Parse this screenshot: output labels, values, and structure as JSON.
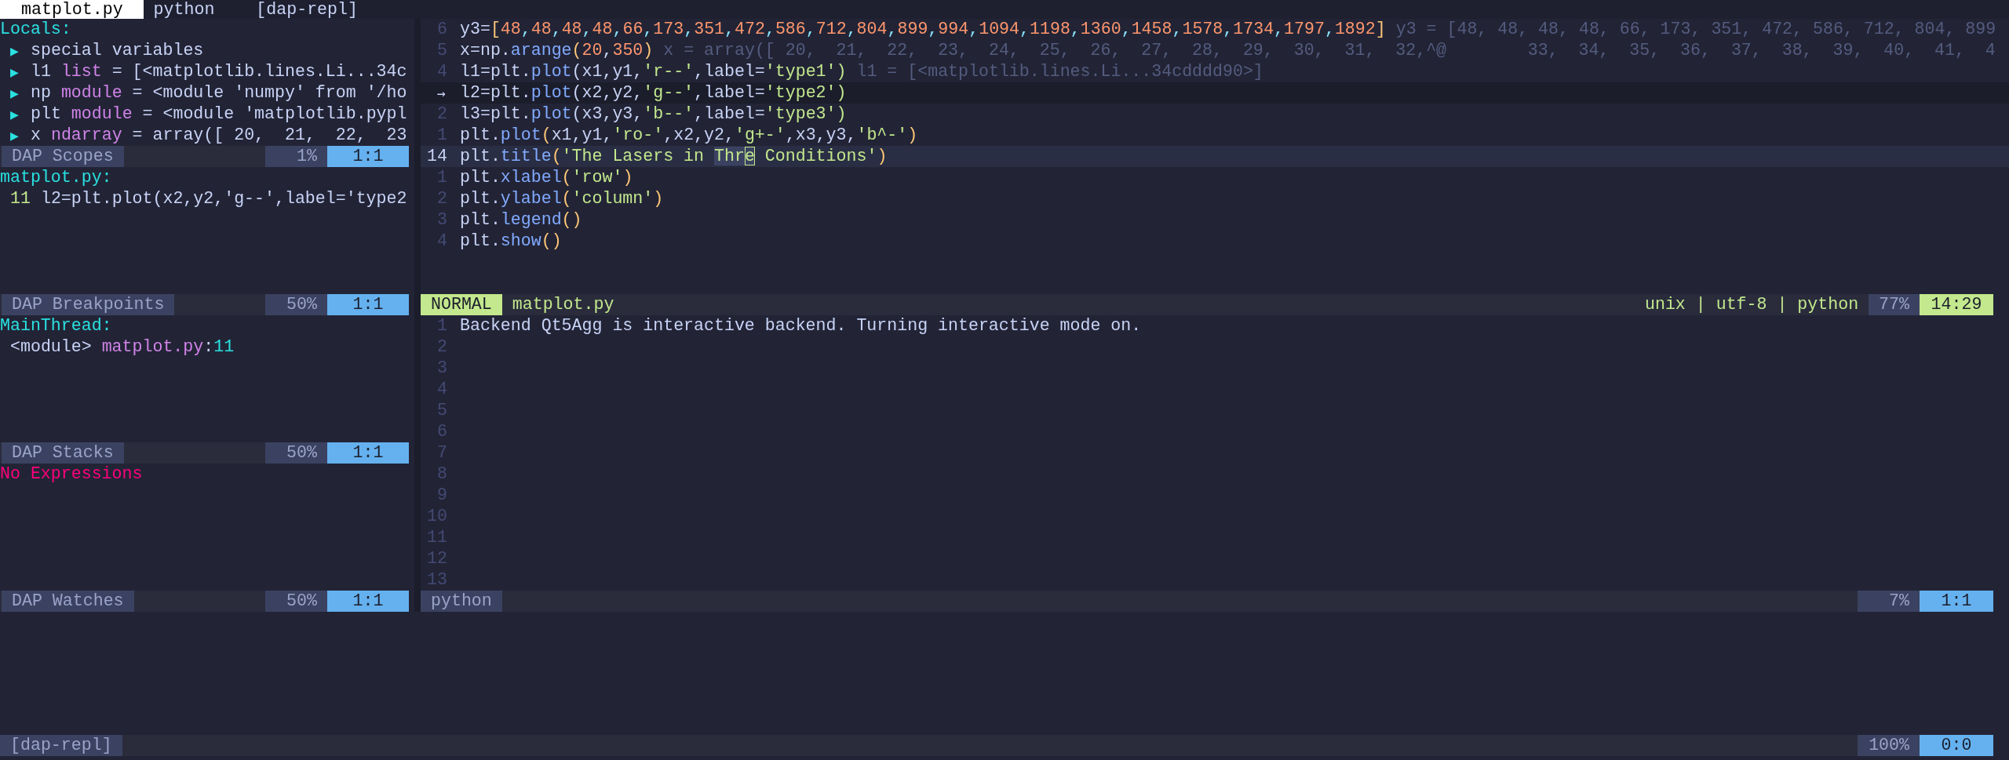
{
  "tabs": [
    {
      "label": "matplot.py",
      "selected": true
    },
    {
      "label": "python",
      "selected": false
    },
    {
      "label": "[dap-repl]",
      "selected": false
    }
  ],
  "scopes": {
    "header": "Locals:",
    "items": [
      {
        "marker": "▶",
        "kind": "group",
        "label": "special variables"
      },
      {
        "marker": "▶",
        "kind": "var",
        "name": "l1",
        "type": "list",
        "value": "= [<matplotlib.lines.Li...34c"
      },
      {
        "marker": "▶",
        "kind": "var",
        "name": "np",
        "type": "module",
        "value": "= <module 'numpy' from '/ho"
      },
      {
        "marker": "▶",
        "kind": "var",
        "name": "plt",
        "type": "module",
        "value": "= <module 'matplotlib.pypl"
      },
      {
        "marker": "▶",
        "kind": "var",
        "name": "x",
        "type": "ndarray",
        "value": "= array([ 20,  21,  22,  23"
      }
    ],
    "status": {
      "label": "DAP Scopes",
      "percent": "1%",
      "position": "1:1"
    }
  },
  "breakpoints": {
    "file": "matplot.py:",
    "lines": [
      {
        "number": "11",
        "code": "l2=plt.plot(x2,y2,'g--',label='type2"
      }
    ],
    "status": {
      "label": "DAP Breakpoints",
      "percent": "50%",
      "position": "1:1"
    }
  },
  "stacks": {
    "thread": "MainThread:",
    "frames": [
      {
        "name": "<module>",
        "file": "matplot.py",
        "separator": ":",
        "line": "11"
      }
    ],
    "status": {
      "label": "DAP Stacks",
      "percent": "50%",
      "position": "1:1"
    }
  },
  "watches": {
    "message": "No Expressions",
    "status": {
      "label": "DAP Watches",
      "percent": "50%",
      "position": "1:1"
    }
  },
  "editor": {
    "lines": [
      {
        "number": "6",
        "stopped": false,
        "cursor": false,
        "tokens": [
          {
            "kind": "plain",
            "text": "y3="
          },
          {
            "kind": "paren",
            "text": "["
          },
          {
            "kind": "array",
            "text": "48,48,48,48,66,173,351,472,586,712,804,899,994,1094,1198,1360,1458,1578,1734,1797,1892"
          },
          {
            "kind": "paren",
            "text": "]"
          }
        ],
        "virtual": "y3 = [48, 48, 48, 48, 66, 173, 351, 472, 586, 712, 804, 899"
      },
      {
        "number": "5",
        "stopped": false,
        "cursor": false,
        "tokens": [
          {
            "kind": "plain",
            "text": "x=np."
          },
          {
            "kind": "func",
            "text": "arange"
          },
          {
            "kind": "paren",
            "text": "("
          },
          {
            "kind": "number",
            "text": "20"
          },
          {
            "kind": "plain",
            "text": ","
          },
          {
            "kind": "number",
            "text": "350"
          },
          {
            "kind": "paren",
            "text": ")"
          }
        ],
        "virtual": "x = array([ 20,  21,  22,  23,  24,  25,  26,  27,  28,  29,  30,  31,  32,^@        33,  34,  35,  36,  37,  38,  39,  40,  41,  4"
      },
      {
        "number": "4",
        "stopped": false,
        "cursor": false,
        "tokens": [
          {
            "kind": "plain",
            "text": "l1=plt."
          },
          {
            "kind": "func",
            "text": "plot"
          },
          {
            "kind": "plain",
            "text": "(x1,y1,"
          },
          {
            "kind": "string",
            "text": "'r--'"
          },
          {
            "kind": "plain",
            "text": ",label="
          },
          {
            "kind": "string",
            "text": "'type1')"
          }
        ],
        "virtual": "l1 = [<matplotlib.lines.Li...34cdddd90>]"
      },
      {
        "number": "→",
        "stopped": true,
        "cursor": false,
        "tokens": [
          {
            "kind": "plain",
            "text": "l2=plt."
          },
          {
            "kind": "func",
            "text": "plot"
          },
          {
            "kind": "plain",
            "text": "(x2,y2,"
          },
          {
            "kind": "string",
            "text": "'g--'"
          },
          {
            "kind": "plain",
            "text": ",label="
          },
          {
            "kind": "string",
            "text": "'type2')"
          }
        ]
      },
      {
        "number": "2",
        "stopped": false,
        "cursor": false,
        "tokens": [
          {
            "kind": "plain",
            "text": "l3=plt."
          },
          {
            "kind": "func",
            "text": "plot"
          },
          {
            "kind": "plain",
            "text": "(x3,y3,"
          },
          {
            "kind": "string",
            "text": "'b--'"
          },
          {
            "kind": "plain",
            "text": ",label="
          },
          {
            "kind": "string",
            "text": "'type3')"
          }
        ]
      },
      {
        "number": "1",
        "stopped": false,
        "cursor": false,
        "tokens": [
          {
            "kind": "plain",
            "text": "plt."
          },
          {
            "kind": "func",
            "text": "plot"
          },
          {
            "kind": "paren",
            "text": "("
          },
          {
            "kind": "plain",
            "text": "x1,y1,"
          },
          {
            "kind": "string",
            "text": "'ro-'"
          },
          {
            "kind": "plain",
            "text": ",x2,y2,"
          },
          {
            "kind": "string",
            "text": "'g+-'"
          },
          {
            "kind": "plain",
            "text": ",x3,y3,"
          },
          {
            "kind": "string",
            "text": "'b^-'"
          },
          {
            "kind": "paren",
            "text": ")"
          }
        ]
      },
      {
        "number": "14",
        "stopped": false,
        "cursor": true,
        "tokens": [
          {
            "kind": "plain",
            "text": "plt."
          },
          {
            "kind": "func",
            "text": "title"
          },
          {
            "kind": "paren",
            "text": "("
          },
          {
            "kind": "string",
            "text": "'The Lasers in "
          },
          {
            "kind": "match",
            "text": "Thr"
          },
          {
            "kind": "cursor",
            "text": "e"
          },
          {
            "kind": "string",
            "text": " Conditions'"
          },
          {
            "kind": "paren",
            "text": ")"
          }
        ]
      },
      {
        "number": "1",
        "stopped": false,
        "cursor": false,
        "tokens": [
          {
            "kind": "plain",
            "text": "plt."
          },
          {
            "kind": "func",
            "text": "xlabel"
          },
          {
            "kind": "paren",
            "text": "("
          },
          {
            "kind": "string",
            "text": "'row'"
          },
          {
            "kind": "paren",
            "text": ")"
          }
        ]
      },
      {
        "number": "2",
        "stopped": false,
        "cursor": false,
        "tokens": [
          {
            "kind": "plain",
            "text": "plt."
          },
          {
            "kind": "func",
            "text": "ylabel"
          },
          {
            "kind": "paren",
            "text": "("
          },
          {
            "kind": "string",
            "text": "'column'"
          },
          {
            "kind": "paren",
            "text": ")"
          }
        ]
      },
      {
        "number": "3",
        "stopped": false,
        "cursor": false,
        "tokens": [
          {
            "kind": "plain",
            "text": "plt."
          },
          {
            "kind": "func",
            "text": "legend"
          },
          {
            "kind": "paren",
            "text": "()"
          }
        ]
      },
      {
        "number": "4",
        "stopped": false,
        "cursor": false,
        "tokens": [
          {
            "kind": "plain",
            "text": "plt."
          },
          {
            "kind": "func",
            "text": "show"
          },
          {
            "kind": "paren",
            "text": "()"
          }
        ]
      }
    ],
    "status": {
      "mode": "NORMAL",
      "file": "matplot.py",
      "info": "unix | utf-8 | python",
      "percent": "77%",
      "position": "14:29"
    }
  },
  "python": {
    "lines": [
      {
        "number": "1",
        "text": "Backend Qt5Agg is interactive backend. Turning interactive mode on."
      },
      {
        "number": "2"
      },
      {
        "number": "3"
      },
      {
        "number": "4"
      },
      {
        "number": "5"
      },
      {
        "number": "6"
      },
      {
        "number": "7"
      },
      {
        "number": "8"
      },
      {
        "number": "9"
      },
      {
        "number": "10"
      },
      {
        "number": "11"
      },
      {
        "number": "12"
      },
      {
        "number": "13"
      }
    ],
    "status": {
      "label": "python",
      "percent": "7%",
      "position": "1:1"
    }
  },
  "repl": {
    "status": {
      "label": "[dap-repl]",
      "percent": "100%",
      "position": "0:0"
    }
  }
}
